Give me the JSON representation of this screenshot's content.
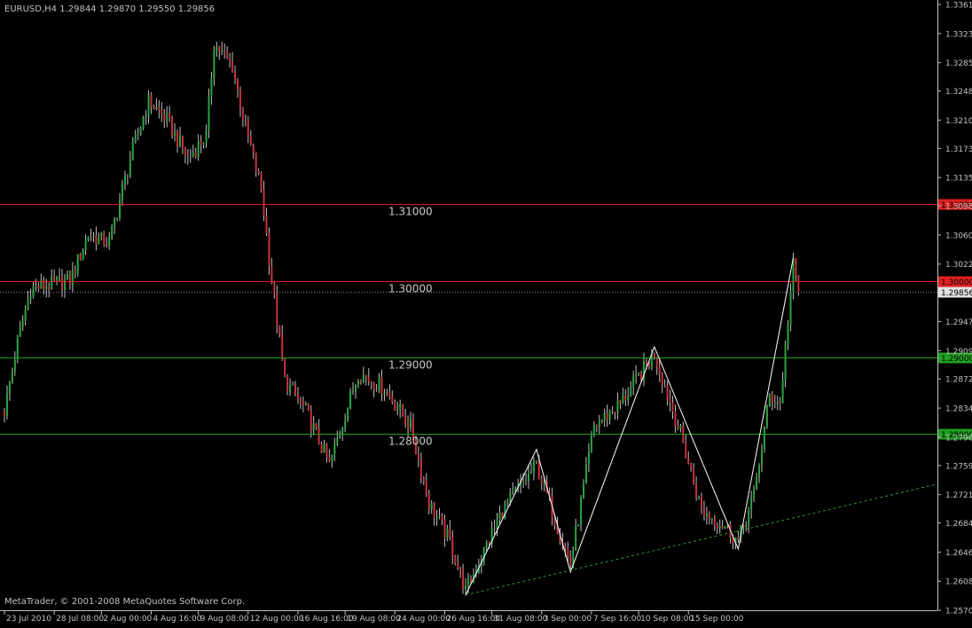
{
  "header": {
    "text": "EURUSD,H4  1.29844 1.29870 1.29550 1.29856"
  },
  "footer": {
    "copyright": "MetaTrader, © 2001-2008 MetaQuotes Software Corp."
  },
  "colors": {
    "background": "#000000",
    "frame": "#c0c0c0",
    "bull": "#26a641",
    "bear": "#c8323c",
    "doji": "#c0c0c0",
    "level_red": "#e02020",
    "level_green": "#20a020",
    "zigzag": "#ffffff",
    "trend": "#2f9a2f"
  },
  "chart_data": {
    "type": "candlestick",
    "symbol": "EURUSD",
    "timeframe": "H4",
    "ohlc_header": {
      "open": 1.29844,
      "high": 1.2987,
      "low": 1.2955,
      "close": 1.29856
    },
    "price_axis_ticks": [
      "1.33610",
      "1.33230",
      "1.32850",
      "1.32480",
      "1.32100",
      "1.31730",
      "1.31350",
      "1.30980",
      "1.30600",
      "1.30220",
      "1.29470",
      "1.29090",
      "1.28720",
      "1.28340",
      "1.27960",
      "1.27590",
      "1.27210",
      "1.26840",
      "1.26460",
      "1.26080",
      "1.25700"
    ],
    "ylim": [
      1.257,
      1.3361
    ],
    "time_axis_ticks": [
      "23 Jul 2010",
      "28 Jul 08:00",
      "2 Aug 00:00",
      "4 Aug 16:00",
      "9 Aug 08:00",
      "12 Aug 00:00",
      "16 Aug 16:00",
      "19 Aug 08:00",
      "24 Aug 00:00",
      "26 Aug 16:00",
      "31 Aug 08:00",
      "3 Sep 00:00",
      "7 Sep 16:00",
      "10 Sep 08:00",
      "15 Sep 00:00"
    ],
    "horizontal_levels": [
      {
        "value": 1.31,
        "label": "1.31000",
        "badge": "1.31000",
        "color": "red"
      },
      {
        "value": 1.3,
        "label": "1.30000",
        "badge": "1.30000",
        "color": "red"
      },
      {
        "value": 1.29,
        "label": "1.29000",
        "badge": "1.29000",
        "color": "green"
      },
      {
        "value": 1.28,
        "label": "1.28000",
        "badge": "1.28000",
        "color": "green"
      }
    ],
    "current_price": {
      "value": 1.29856,
      "label": "1.29856"
    },
    "zigzag_pivots": [
      {
        "bar": 176,
        "price": 1.259
      },
      {
        "bar": 203,
        "price": 1.278
      },
      {
        "bar": 216,
        "price": 1.262
      },
      {
        "bar": 248,
        "price": 1.2914
      },
      {
        "bar": 280,
        "price": 1.265
      },
      {
        "bar": 301,
        "price": 1.303
      }
    ],
    "trendline": {
      "from": {
        "bar": 176,
        "price": 1.259
      },
      "to": {
        "bar": 355,
        "price": 1.2734
      }
    },
    "bar_count": 304,
    "path_anchors": [
      {
        "bar": 0,
        "price": 1.283
      },
      {
        "bar": 5,
        "price": 1.292
      },
      {
        "bar": 10,
        "price": 1.299
      },
      {
        "bar": 25,
        "price": 1.3
      },
      {
        "bar": 32,
        "price": 1.306
      },
      {
        "bar": 40,
        "price": 1.305
      },
      {
        "bar": 48,
        "price": 1.316
      },
      {
        "bar": 55,
        "price": 1.3235
      },
      {
        "bar": 62,
        "price": 1.321
      },
      {
        "bar": 70,
        "price": 1.316
      },
      {
        "bar": 77,
        "price": 1.319
      },
      {
        "bar": 80,
        "price": 1.331
      },
      {
        "bar": 87,
        "price": 1.328
      },
      {
        "bar": 92,
        "price": 1.32
      },
      {
        "bar": 98,
        "price": 1.312
      },
      {
        "bar": 102,
        "price": 1.3
      },
      {
        "bar": 107,
        "price": 1.287
      },
      {
        "bar": 115,
        "price": 1.283
      },
      {
        "bar": 124,
        "price": 1.276
      },
      {
        "bar": 135,
        "price": 1.288
      },
      {
        "bar": 145,
        "price": 1.286
      },
      {
        "bar": 155,
        "price": 1.281
      },
      {
        "bar": 162,
        "price": 1.271
      },
      {
        "bar": 170,
        "price": 1.266
      },
      {
        "bar": 176,
        "price": 1.2595
      },
      {
        "bar": 190,
        "price": 1.27
      },
      {
        "bar": 203,
        "price": 1.276
      },
      {
        "bar": 216,
        "price": 1.263
      },
      {
        "bar": 225,
        "price": 1.281
      },
      {
        "bar": 235,
        "price": 1.284
      },
      {
        "bar": 248,
        "price": 1.2905
      },
      {
        "bar": 258,
        "price": 1.28
      },
      {
        "bar": 266,
        "price": 1.27
      },
      {
        "bar": 275,
        "price": 1.268
      },
      {
        "bar": 280,
        "price": 1.266
      },
      {
        "bar": 286,
        "price": 1.272
      },
      {
        "bar": 292,
        "price": 1.285
      },
      {
        "bar": 296,
        "price": 1.284
      },
      {
        "bar": 301,
        "price": 1.302
      },
      {
        "bar": 303,
        "price": 1.2985
      }
    ]
  }
}
